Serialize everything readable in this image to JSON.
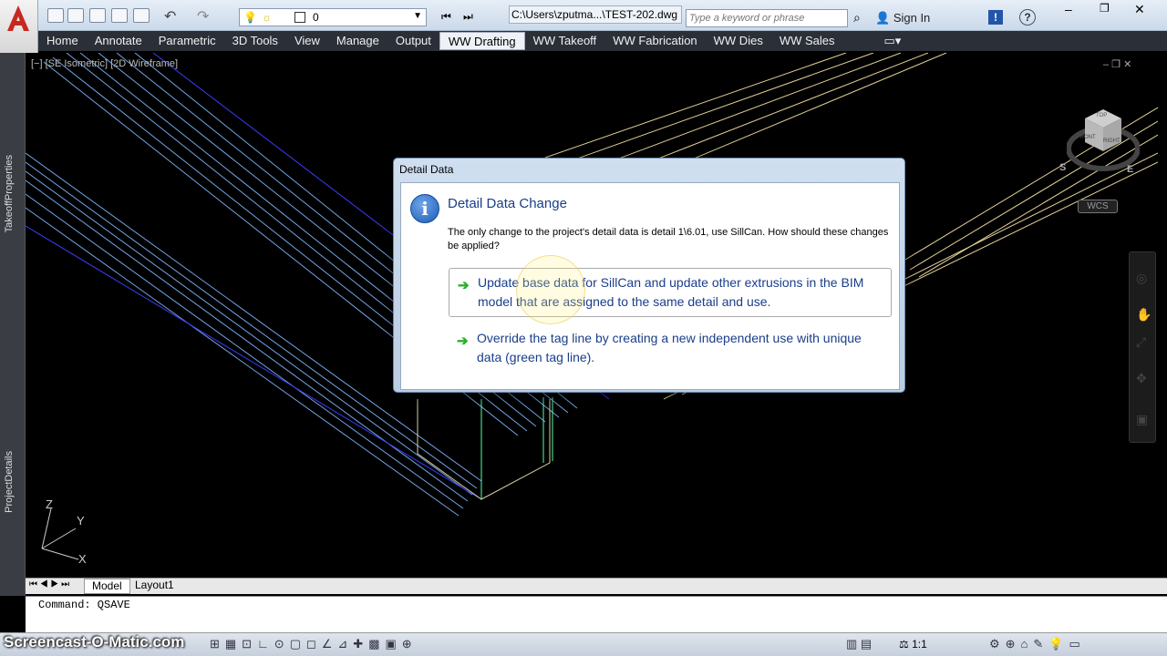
{
  "quick_access": {
    "workspace_value": "0",
    "document_title": "C:\\Users\\zputma...\\TEST-202.dwg",
    "search_placeholder": "Type a keyword or phrase",
    "sign_in_label": "Sign In"
  },
  "ribbon_tabs": [
    {
      "label": "Home"
    },
    {
      "label": "Annotate"
    },
    {
      "label": "Parametric"
    },
    {
      "label": "3D Tools"
    },
    {
      "label": "View"
    },
    {
      "label": "Manage"
    },
    {
      "label": "Output"
    },
    {
      "label": "WW Drafting",
      "active": true
    },
    {
      "label": "WW Takeoff"
    },
    {
      "label": "WW Fabrication"
    },
    {
      "label": "WW Dies"
    },
    {
      "label": "WW Sales"
    }
  ],
  "viewport": {
    "label": "[−] [SE Isometric] [2D Wireframe]",
    "wcs_label": "WCS",
    "ucs": {
      "z": "Z",
      "y": "Y",
      "x": "X"
    },
    "compass": {
      "s": "S",
      "e": "E"
    },
    "cube_faces": {
      "top": "TOP",
      "front": "FRONT",
      "right": "RIGHT"
    }
  },
  "side_palettes": [
    "TakeoffProperties",
    "ProjectDetails"
  ],
  "layout_tabs": [
    {
      "label": "Model",
      "active": true
    },
    {
      "label": "Layout1"
    }
  ],
  "command_line": "Command: QSAVE",
  "status_scale": "1:1",
  "watermark": "Screencast-O-Matic.com",
  "dialog": {
    "title": "Detail Data",
    "main_instruction": "Detail Data Change",
    "content": "The only change to the project's detail data is detail 1\\6.01, use SillCan.  How should these changes be applied?",
    "options": [
      {
        "label": "Update base data for SillCan and update other extrusions in the BIM model that are assigned to the same detail and use."
      },
      {
        "label": "Override the tag line by creating a new independent use with unique data (green tag line)."
      }
    ]
  },
  "colors": {
    "accent_blue": "#1a3e8a",
    "arrow_green": "#2bb02b",
    "ribbon_dark": "#2b2f38"
  }
}
